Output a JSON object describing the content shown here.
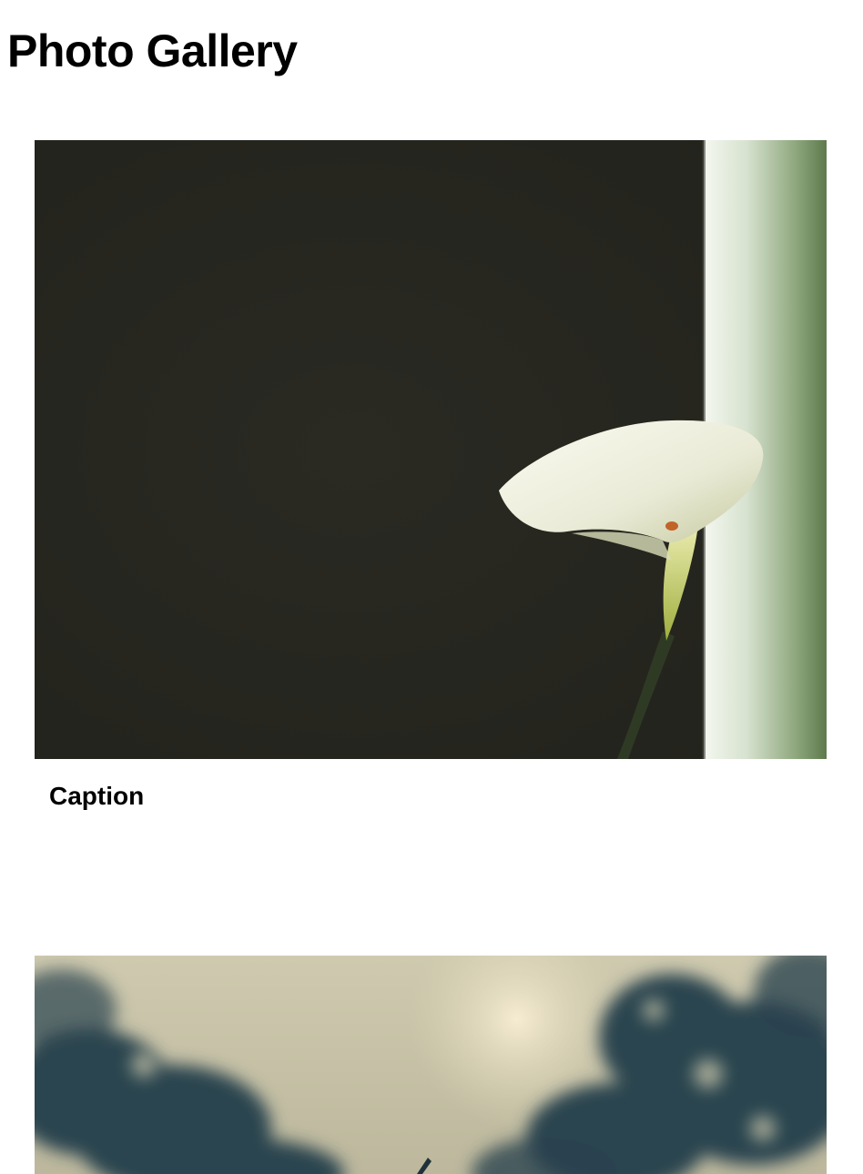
{
  "page": {
    "title": "Photo Gallery"
  },
  "gallery": {
    "items": [
      {
        "caption": "Caption",
        "image": "calla-lily-photo",
        "colors": {
          "background": "#272720",
          "petal": "#f2f2e4",
          "accent": "#c8d06a",
          "window": "#e6eee0"
        }
      },
      {
        "caption": "",
        "image": "blurred-trees-sky-photo",
        "colors": {
          "sky": "#d9d2b4",
          "foliage": "#2d4650",
          "sun": "#f3e6c8"
        }
      }
    ]
  }
}
